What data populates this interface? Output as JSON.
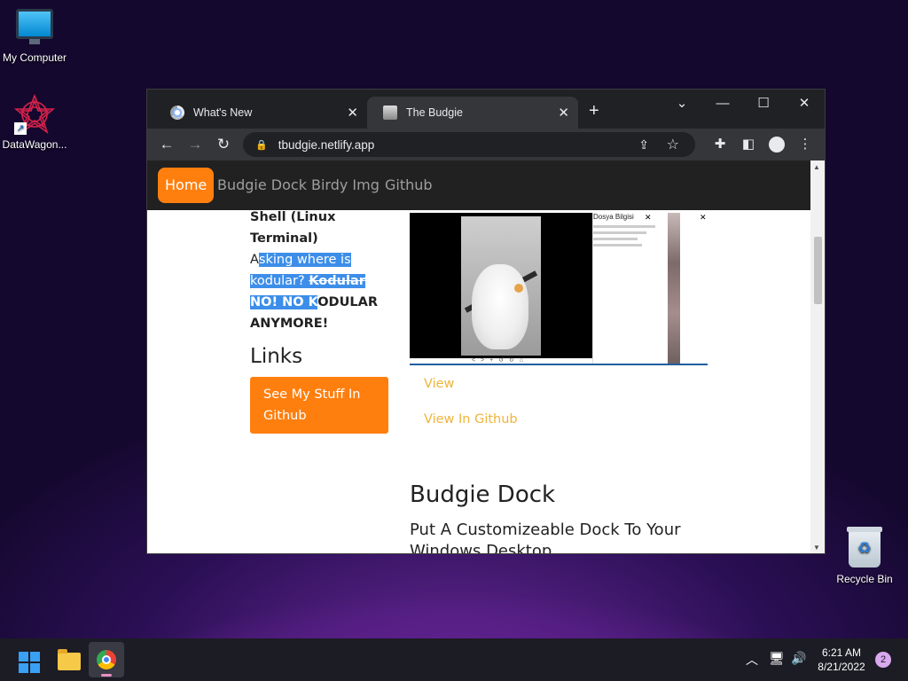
{
  "desktop": {
    "icons": [
      {
        "label": "My Computer",
        "icon": "monitor-icon"
      },
      {
        "label": "DataWagon...",
        "icon": "datawagon-icon"
      },
      {
        "label": "Recycle Bin",
        "icon": "recycle-bin-icon"
      }
    ]
  },
  "browser": {
    "tabs": [
      {
        "title": "What's New",
        "favicon": "chrome-icon",
        "active": false
      },
      {
        "title": "The Budgie",
        "favicon": "budgie-favicon",
        "active": true
      }
    ],
    "url": "tbudgie.netlify.app",
    "nav_glyphs": {
      "back": "←",
      "forward": "→",
      "reload": "↻",
      "new_tab": "+",
      "close": "✕",
      "down": "⌄",
      "minimize": "—",
      "maximize": "☐",
      "window_close": "✕",
      "share": "⇪",
      "star": "☆",
      "extensions": "✚",
      "panel": "◧",
      "menu": "⋮",
      "lock": "🔒"
    }
  },
  "site": {
    "nav": [
      {
        "label": "Home",
        "active": true
      },
      {
        "label": "Budgie Dock",
        "active": false
      },
      {
        "label": "Birdy Img",
        "active": false
      },
      {
        "label": "Github",
        "active": false
      }
    ],
    "left": {
      "heading_line1": "Shell (Linux",
      "heading_line2": "Terminal)",
      "q_a": "A",
      "q_sel1": "sking where is",
      "q_sel2": "kodular? ",
      "q_strike": "Kodular",
      "bold_sel": "NO! NO K",
      "bold_rest": "ODULAR",
      "bold_last": "ANYMORE!",
      "links_heading": "Links",
      "github_button": "See My Stuff In Github"
    },
    "project": {
      "dialog_title": "Dosya Bilgisi",
      "image_toolbar": "< > + ↺ ↻ ⌂",
      "view_link": "View",
      "github_link": "View In Github"
    },
    "section": {
      "title": "Budgie Dock",
      "subtitle": "Put A Customizeable Dock To Your Windows Desktop"
    },
    "colors": {
      "accent": "#ff7f0e",
      "link": "#f0b43a",
      "navbar": "#212121",
      "selection": "#3d8ee9"
    }
  },
  "taskbar": {
    "time": "6:21 AM",
    "date": "8/21/2022",
    "notifications": "2",
    "tray_glyphs": {
      "chevron": "︿",
      "network": "🖥",
      "volume": "🔊"
    }
  }
}
